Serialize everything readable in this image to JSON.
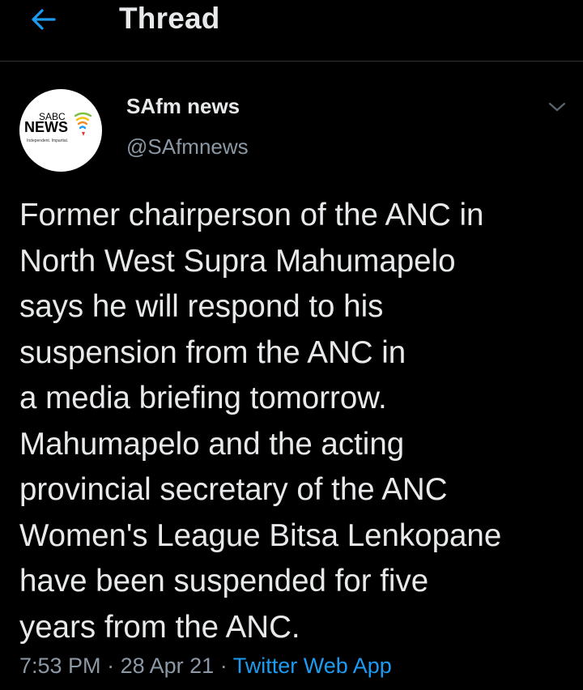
{
  "header": {
    "title": "Thread",
    "back_icon": "arrow-left-icon",
    "accent_color": "#1d9bf0"
  },
  "tweet": {
    "author": {
      "name": "SAfm news",
      "handle": "@SAfmnews",
      "avatar_logo": {
        "line1": "SABC",
        "line2": "NEWS",
        "tagline": "Independent. Impartial."
      }
    },
    "more_icon": "chevron-down-icon",
    "text": "Former chairperson of the ANC in\nNorth West Supra Mahumapelo\nsays he will respond to his\nsuspension from the ANC in\na media briefing tomorrow.\nMahumapelo and the acting\nprovincial secretary of the ANC\nWomen's League Bitsa Lenkopane\nhave been suspended for five\nyears from the ANC.",
    "time": "7:53 PM",
    "separator": "·",
    "date": "28 Apr 21",
    "source": "Twitter Web App"
  }
}
